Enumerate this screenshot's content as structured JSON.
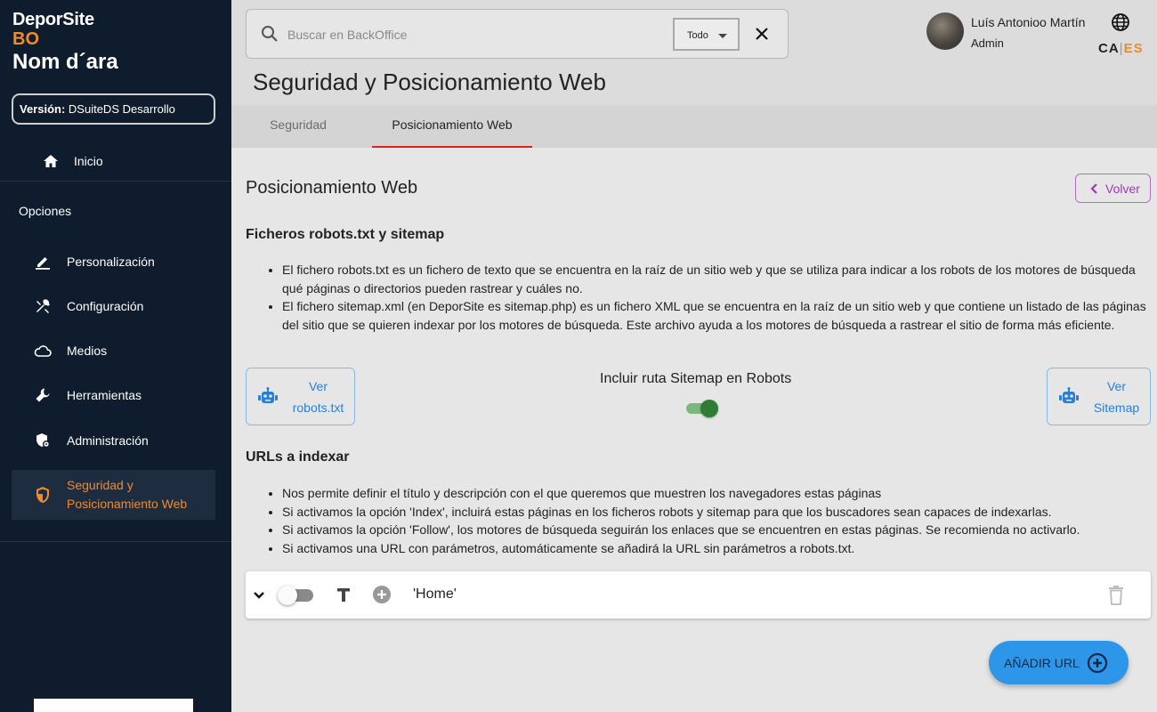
{
  "sidebar": {
    "brand_line1": "DeporSite",
    "brand_line2": "BO",
    "brand_line3": "Nom d´ara",
    "version_label": "Versión:",
    "version_value": " DSuiteDS Desarrollo",
    "home": {
      "label": "Inicio",
      "icon": "home-icon"
    },
    "section_label": "Opciones",
    "items": [
      {
        "label": "Personalización",
        "icon": "pencil-icon"
      },
      {
        "label": "Configuración",
        "icon": "tools-icon"
      },
      {
        "label": "Medios",
        "icon": "cloud-icon"
      },
      {
        "label": "Herramientas",
        "icon": "wrench-icon"
      },
      {
        "label": "Administración",
        "icon": "admin-shield-icon"
      },
      {
        "label": "Seguridad y Posicionamiento Web",
        "icon": "security-shield-icon",
        "active": true
      }
    ]
  },
  "search": {
    "placeholder": "Buscar en BackOffice",
    "filter_value": "Todo"
  },
  "user": {
    "name": "Luís Antonioo Martín",
    "role": "Admin"
  },
  "language": {
    "ca": "CA",
    "separator": "|",
    "es": "ES",
    "active": "ES"
  },
  "page": {
    "title": "Seguridad y Posicionamiento Web",
    "tabs": [
      {
        "label": "Seguridad",
        "active": false
      },
      {
        "label": "Posicionamiento Web",
        "active": true
      }
    ]
  },
  "content": {
    "section_title": "Posicionamiento Web",
    "back_label": "Volver",
    "robots_heading": "Ficheros robots.txt y sitemap",
    "robots_bullets": [
      "El fichero robots.txt es un fichero de texto que se encuentra en la raíz de un sitio web y que se utiliza para indicar a los robots de los motores de búsqueda qué páginas o directorios pueden rastrear y cuáles no.",
      "El fichero sitemap.xml (en DeporSite es sitemap.php) es un fichero XML que se encuentra en la raíz de un sitio web y que contiene un listado de las páginas del sitio que se quieren indexar por los motores de búsqueda. Este archivo ayuda a los motores de búsqueda a rastrear el sitio de forma más eficiente."
    ],
    "view_robots_line1": "Ver",
    "view_robots_line2": "robots.txt",
    "sitemap_toggle_label": "Incluir ruta Sitemap en Robots",
    "sitemap_toggle_on": true,
    "view_sitemap_line1": "Ver",
    "view_sitemap_line2": "Sitemap",
    "urls_heading": "URLs a indexar",
    "urls_bullets": [
      "Nos permite definir el título y descripción con el que queremos que muestren los navegadores estas páginas",
      "Si activamos la opción 'Index', incluirá estas páginas en los ficheros robots y sitemap para que los buscadores sean capaces de indexarlas.",
      "Si activamos la opción 'Follow', los motores de búsqueda seguirán los enlaces que se encuentren en estas páginas. Se recomienda no activarlo.",
      "Si activamos una URL con parámetros, automáticamente se añadirá la URL sin parámetros a robots.txt."
    ],
    "url_rows": [
      {
        "name": "'Home'",
        "enabled": false
      }
    ],
    "add_url_label": "AÑADIR URL"
  },
  "colors": {
    "sidebar_bg": "#0f1c2e",
    "accent_orange": "#f08a2b",
    "tab_underline": "#e02020",
    "back_button": "#9c3bb0",
    "link_blue": "#2a7fd4",
    "fab_blue": "#2d96e8",
    "toggle_green": "#2e7d32"
  }
}
